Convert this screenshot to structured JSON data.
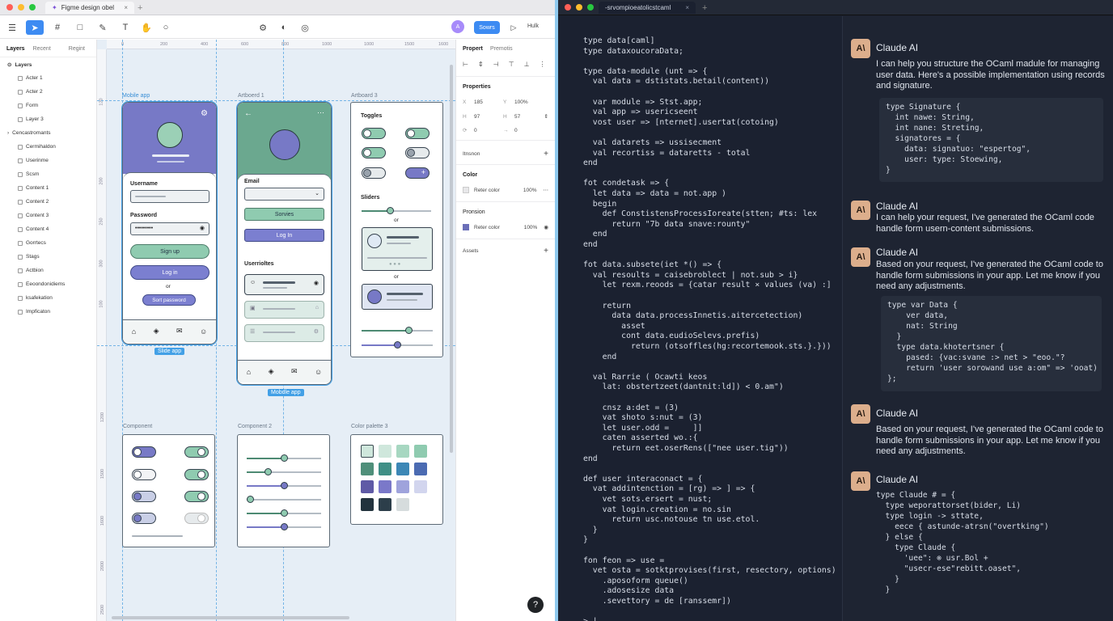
{
  "figma": {
    "tab_title": "Figme design obel",
    "toolbar": {
      "share_label": "Sowrs",
      "zoom_label": "Hulk"
    },
    "left_panel": {
      "tabs": [
        "Layers",
        "Recent",
        "Regint"
      ],
      "root": "Layers",
      "items": [
        "Acter 1",
        "Acter 2",
        "Form",
        "Layer 3",
        "Cencastromants",
        "Cermihaldon",
        "Userinme",
        "Scsm",
        "Content 1",
        "Content 2",
        "Content 3",
        "Content 4",
        "Gorrtecs",
        "Stags",
        "Actbion",
        "Eeoondonidiems",
        "ksafekation",
        "Impficaton"
      ]
    },
    "ruler_h": [
      "0",
      "200",
      "400",
      "600",
      "800",
      "1000",
      "1000",
      "1500",
      "1600",
      "1800"
    ],
    "ruler_v": [
      "120",
      "200",
      "250",
      "300",
      "100",
      "1200",
      "1500",
      "1600",
      "2000",
      "2500"
    ],
    "frames": {
      "f1_label": "Mobile app",
      "f2_label": "Artboerd 1",
      "f3_label": "Artboard 3",
      "f4_label": "Component",
      "f5_label": "Component 2",
      "f6_label": "Color palette 3",
      "tag1": "Slide app",
      "tag2": "Mobdle app"
    },
    "login": {
      "username_label": "Username",
      "password_label": "Password",
      "password_value": "•••••••••",
      "signup": "Sign up",
      "login": "Log in",
      "or": "or",
      "sort": "Sort password"
    },
    "email_form": {
      "email_label": "Email",
      "services": "Sorvies",
      "login": "Log In",
      "list_title": "Userrioltes"
    },
    "toggles": {
      "title": "Toggles",
      "sliders": "Sliders",
      "or1": "or",
      "or2": "or"
    },
    "right_panel": {
      "tabs": [
        "Propert",
        "Premotis"
      ],
      "properties": "Properties",
      "x": "185",
      "w": "100%",
      "h": "97",
      "h2": "57",
      "r1": "0",
      "r2": "0",
      "section_interaction": "Itnsnon",
      "color_label": "Color",
      "color_name": "Reter color",
      "color_opacity": "100%",
      "pronsion_label": "Pronsion",
      "pron_name": "Reter color",
      "pron_opacity": "100%",
      "assets": "Assets"
    },
    "help": "?"
  },
  "terminal": {
    "tab_title": "-srvompioeatolicstcaml",
    "code_lines": [
      "type data[caml]",
      "type dataxoucoraData;",
      "",
      "type data-module (unt => {",
      "  val data = dstistats.betail(content))",
      "",
      "  var module => Stst.app;",
      "  val app => usericseent",
      "  vost user => [nternet].usertat(cotoing)",
      "",
      "  val datarets => ussisecment",
      "  val recortiss = dataretts - total",
      "end",
      "",
      "fot condetask => {",
      "  let data => data = not.app )",
      "  begin",
      "    def ConstistensProcessIoreate(stten; #ts: lex",
      "      return \"7b data snave:rounty\"",
      "  end",
      "end",
      "",
      "fot data.subsete(iet *() => {",
      "  val resoults = caisebroblect | not.sub > i}",
      "    let rexm.reoods = {catar result × values (va) :]",
      "",
      "    return",
      "      data data.processInnetis.aitercetection)",
      "        asset",
      "        cont data.eudioSelevs.prefis)",
      "          return (otsoffles(hg:recortemook.sts.}.}))",
      "    end",
      "",
      "  val Rarrie ( Ocawti keos",
      "    lat: obstertzeet(dantnit:ld]) < 0.am\")",
      "",
      "    cnsz a:det = (3)",
      "    vat shoto s:nut = (3)",
      "    let user.odd =     ]]",
      "    caten asserted wo.:{",
      "      return eet.oserRens([\"nee user.tig\"))",
      "end",
      "",
      "def user interaconact = {",
      "  vat addintenction = [rg) => ] => {",
      "    vet sots.ersert = nust;",
      "    vat login.creation = no.sin",
      "      return usc.notouse tn use.etol.",
      "  }",
      "}",
      "",
      "fon feon => use =",
      "  vet osta = sotktprovises(first, resectory, options)",
      "    .aposoform queue()",
      "    .adosesize data",
      "    .sevettory = de [ranssemr])",
      "",
      "> |"
    ],
    "chat": [
      {
        "name": "Claude AI",
        "text": "I can help you structure the OCaml madule for managing user data. Here's a possible implementation using records and signature.",
        "code": [
          "type Signature {",
          "  int nawe: String,",
          "  int nane: Streting,",
          "  signatores = {",
          "    data: signatuo: \"espertog\",",
          "    user: type: Stoewing,",
          "}"
        ]
      },
      {
        "name": "Claude AI",
        "text": "I can help your request, I've generated the OCaml code handle form usern-content submissions.",
        "code": []
      },
      {
        "name": "Claude AI",
        "text": "Based on your request, I've generated the OCaml code to handle form submissions in your app. Let me know if you need any adjustments.",
        "code": [
          "type var Data {",
          "    ver data,",
          "    nat: String",
          "  }",
          "  type data.khotertsner {",
          "    pased: {vac:svane :> net > \"eoo.\"?",
          "    return 'user sorowand use a:om\" => 'ooat)",
          "};"
        ]
      },
      {
        "name": "Claude AI",
        "text": "Based on your request, I've generated the OCaml code to handle form submissions in your app. Let me know if you need any adjustments.",
        "code": []
      },
      {
        "name": "Claude AI",
        "text": "",
        "code": [
          "type Claude # = {",
          "  type weporattorset(bider, Li)",
          "  type login -> sttate,",
          "    eece { astunde-atrsn(\"overtking\")",
          "  } else {",
          "    type Claude {",
          "      'uee\": ⊗ usr.Bol +",
          "      \"usecr-ese\"rebitt.oaset\",",
          "    }",
          "  }"
        ]
      }
    ]
  },
  "colors": {
    "accent": "#43a0e6",
    "purple": "#7b7fd0",
    "green": "#8fcbb0",
    "terminal_bg": "#1b2130"
  }
}
